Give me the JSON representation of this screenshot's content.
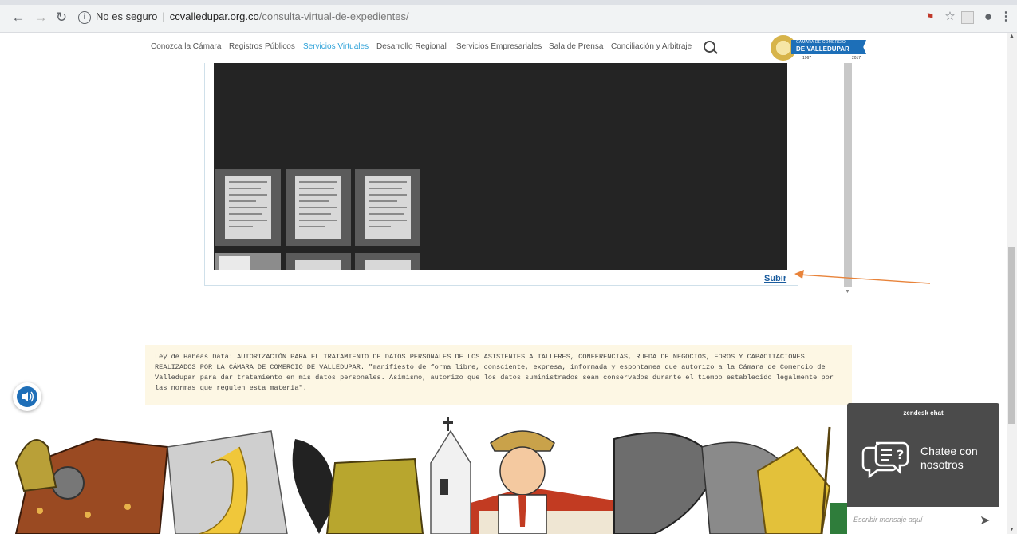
{
  "browser": {
    "security_label": "No es seguro",
    "url_host": "ccvalledupar.org.co",
    "url_path": "/consulta-virtual-de-expedientes/"
  },
  "nav": {
    "items": [
      "Conozca la Cámara",
      "Registros Públicos",
      "Servicios Virtuales",
      "Desarrollo Regional",
      "Servicios Empresariales",
      "Sala de Prensa",
      "Conciliación y Arbitraje"
    ],
    "active_index": 2
  },
  "logo": {
    "line1": "CÁMARA DE COMERCIO",
    "line2": "DE VALLEDUPAR",
    "year_start": "1967",
    "year_end": "2017"
  },
  "viewer": {
    "subir_label": "Subir"
  },
  "habeas": {
    "text": "Ley de Habeas Data: AUTORIZACIÓN PARA EL TRATAMIENTO DE DATOS PERSONALES DE LOS ASISTENTES A TALLERES, CONFERENCIAS, RUEDA DE NEGOCIOS, FOROS Y CAPACITACIONES REALIZADOS POR LA CÁMARA DE COMERCIO DE VALLEDUPAR. \"manifiesto de forma libre, consciente, expresa, informada y espontanea que autorizo a la Cámara de Comercio de Valledupar para dar tratamiento en mis datos personales. Asimismo, autorizo que los datos suministrados sean conservados durante el tiempo establecido legalmente por las normas que regulen esta materia\"."
  },
  "chat": {
    "brand": "zendesk chat",
    "cta": "Chatee con nosotros",
    "placeholder": "Escribir mensaje aquí"
  },
  "colors": {
    "accent": "#2aa0d8",
    "annotation": "#e8833a",
    "chat_bg": "#4b4b4b",
    "notice_bg": "#fdf7e4"
  }
}
